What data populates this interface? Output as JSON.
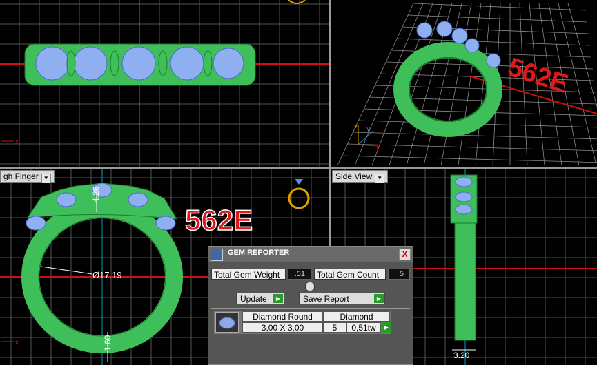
{
  "viewports": {
    "top": {
      "axis_x": "x"
    },
    "perspective": {
      "badge": "562E",
      "axis_z": "z",
      "axis_y": "y",
      "axis_x": "x"
    },
    "front": {
      "label": "gh Finger",
      "badge": "562E",
      "dim_height": "4.26",
      "dim_diameter": "Ø17.19",
      "dim_shank": "1.60",
      "axis_x": "x"
    },
    "side": {
      "label": "Side View",
      "dim_width": "3.20"
    }
  },
  "gem_reporter": {
    "title": "GEM REPORTER",
    "close": "X",
    "total_weight_label": "Total Gem Weight",
    "total_weight_value": ".51",
    "total_count_label": "Total Gem Count",
    "total_count_value": "5",
    "update_label": "Update",
    "save_label": "Save Report",
    "row": {
      "shape": "Diamond Round",
      "type": "Diamond",
      "size": "3,00 X 3,00",
      "count": "5",
      "weight": "0,51tw"
    }
  },
  "colors": {
    "metal": "#3fbf5a",
    "gem": "#8fb0f0",
    "grid": "#5a5a5a",
    "axis_red": "#d01010",
    "axis_cyan": "#00a0c0",
    "badge_red": "#e01818"
  },
  "icons": [
    "ring-preview-icon",
    "gem-app-icon",
    "close-icon",
    "play-arrow-icon",
    "gem-thumbnail-icon"
  ]
}
